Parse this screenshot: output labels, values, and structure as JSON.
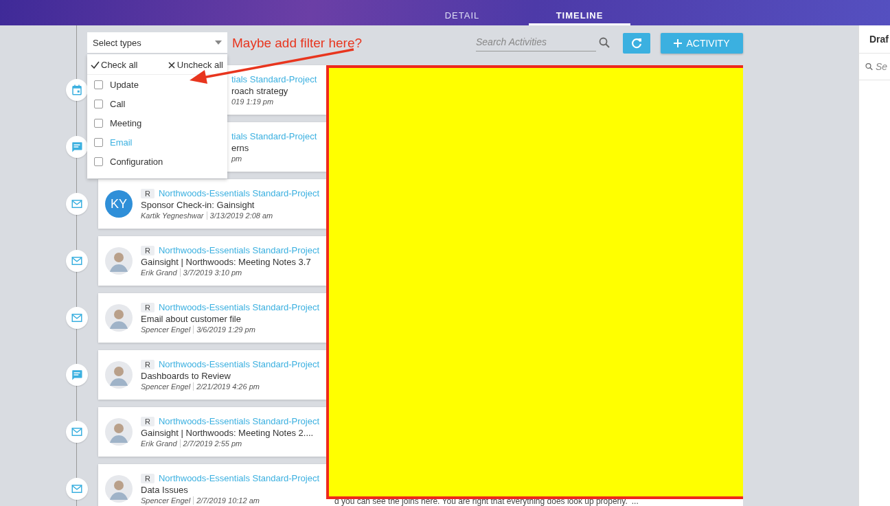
{
  "header": {
    "tabs": [
      {
        "label": "DETAIL",
        "selected": false
      },
      {
        "label": "TIMELINE",
        "selected": true
      }
    ]
  },
  "filter": {
    "placeholder": "Select types",
    "check_all": "Check all",
    "uncheck_all": "Uncheck all",
    "options": [
      {
        "label": "Update",
        "checked": false,
        "highlighted": false
      },
      {
        "label": "Call",
        "checked": false,
        "highlighted": false
      },
      {
        "label": "Meeting",
        "checked": false,
        "highlighted": false
      },
      {
        "label": "Email",
        "checked": false,
        "highlighted": true
      },
      {
        "label": "Configuration",
        "checked": false,
        "highlighted": false
      }
    ]
  },
  "annotation": {
    "text": "Maybe add filter here?"
  },
  "search": {
    "placeholder": "Search Activities"
  },
  "add_button": {
    "label": "ACTIVITY"
  },
  "activities": [
    {
      "kind": "meeting",
      "project": "tials Standard-Project",
      "title": "roach strategy",
      "date": "019 1:19 pm"
    },
    {
      "kind": "note",
      "project": "tials Standard-Project",
      "title": "erns",
      "date": "pm"
    },
    {
      "kind": "email",
      "initials": "KY",
      "badge": "R",
      "project": "Northwoods-Essentials Standard-Project",
      "title": "Sponsor Check-in: Gainsight",
      "author": "Kartik Yegneshwar",
      "date": "3/13/2019 2:08 am"
    },
    {
      "kind": "email",
      "badge": "R",
      "project": "Northwoods-Essentials Standard-Project",
      "title": "Gainsight | Northwoods: Meeting Notes 3.7",
      "author": "Erik Grand",
      "date": "3/7/2019 3:10 pm"
    },
    {
      "kind": "email",
      "badge": "R",
      "project": "Northwoods-Essentials Standard-Project",
      "title": "Email about customer file",
      "author": "Spencer Engel",
      "date": "3/6/2019 1:29 pm"
    },
    {
      "kind": "note",
      "badge": "R",
      "project": "Northwoods-Essentials Standard-Project",
      "title": "Dashboards to Review",
      "author": "Spencer Engel",
      "date": "2/21/2019 4:26 pm"
    },
    {
      "kind": "email",
      "badge": "R",
      "project": "Northwoods-Essentials Standard-Project",
      "title": "Gainsight | Northwoods: Meeting Notes 2....",
      "author": "Erik Grand",
      "date": "2/7/2019 2:55 pm"
    },
    {
      "kind": "email",
      "badge": "R",
      "project": "Northwoods-Essentials Standard-Project",
      "title": "Data Issues",
      "author": "Spencer Engel",
      "date": "2/7/2019 10:12 am"
    }
  ],
  "detail_preview": {
    "text": "d you can see the joins here. You are right that everything does look up properly.",
    "more": "..."
  },
  "side_panel": {
    "title": "Draf",
    "search_placeholder": "Se"
  }
}
